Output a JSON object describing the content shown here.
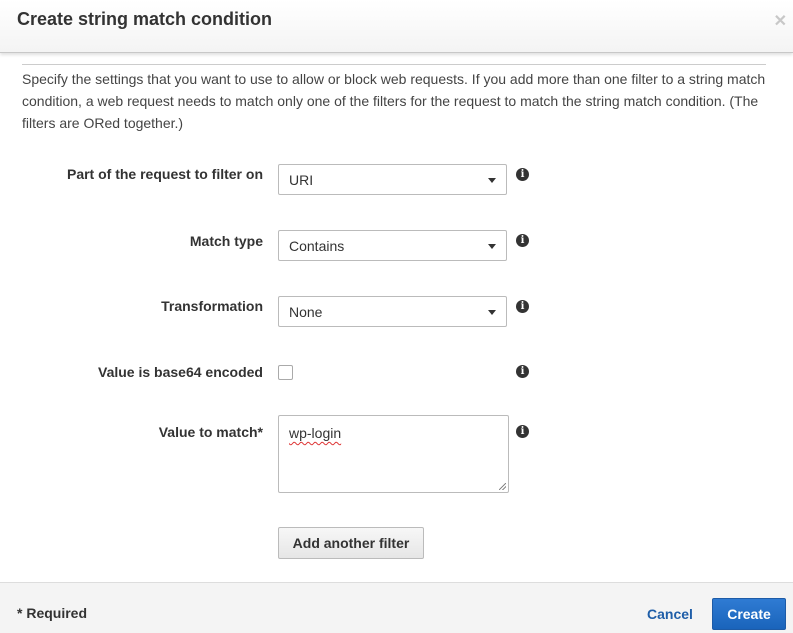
{
  "dialog": {
    "title": "Create string match condition",
    "close_icon": "close-icon"
  },
  "form": {
    "description": "Specify the settings that you want to use to allow or block web requests. If you add more than one filter to a string match condition, a web request needs to match only one of the filters for the request to match the string match condition. (The filters are ORed together.)",
    "part_label": "Part of the request to filter on",
    "part_value": "URI",
    "match_type_label": "Match type",
    "match_type_value": "Contains",
    "transformation_label": "Transformation",
    "transformation_value": "None",
    "base64_label": "Value is base64 encoded",
    "value_label": "Value to match*",
    "value": "wp-login",
    "add_filter_label": "Add another filter",
    "info_icon": "info-icon"
  },
  "footer": {
    "required_note": "* Required",
    "cancel_label": "Cancel",
    "create_label": "Create"
  }
}
